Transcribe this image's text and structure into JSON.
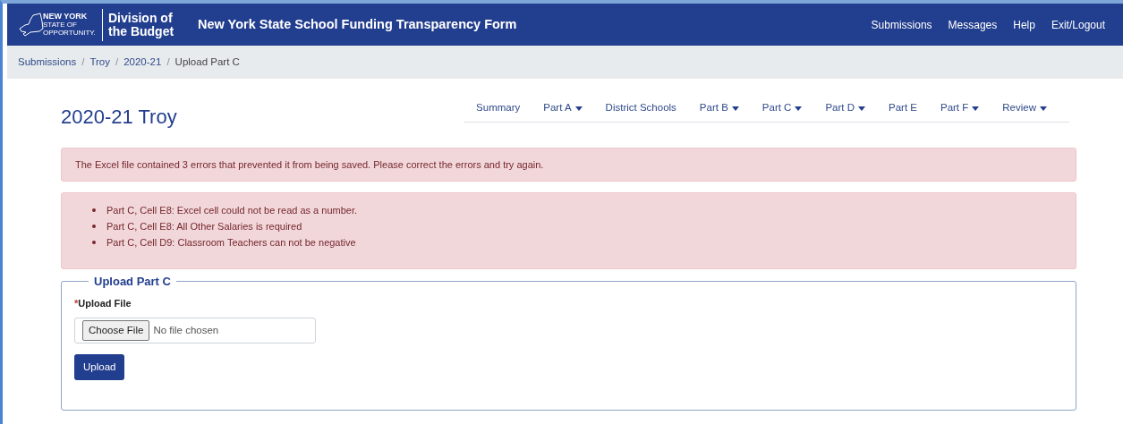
{
  "header": {
    "logo": {
      "state_name": "NEW YORK",
      "tagline": "STATE OF OPPORTUNITY.",
      "agency": "Division of the Budget"
    },
    "title": "New York State School Funding Transparency Form",
    "menu": [
      "Submissions",
      "Messages",
      "Help",
      "Exit/Logout"
    ]
  },
  "breadcrumb": {
    "links": [
      "Submissions",
      "Troy",
      "2020-21"
    ],
    "separator": "/",
    "current": "Upload Part C"
  },
  "page_title": "2020-21 Troy",
  "tabs": [
    {
      "label": "Summary",
      "dropdown": false
    },
    {
      "label": "Part A",
      "dropdown": true
    },
    {
      "label": "District Schools",
      "dropdown": false
    },
    {
      "label": "Part B",
      "dropdown": true
    },
    {
      "label": "Part C",
      "dropdown": true
    },
    {
      "label": "Part D",
      "dropdown": true
    },
    {
      "label": "Part E",
      "dropdown": false
    },
    {
      "label": "Part F",
      "dropdown": true
    },
    {
      "label": "Review",
      "dropdown": true
    }
  ],
  "error_summary": "The Excel file contained 3 errors that prevented it from being saved. Please correct the errors and try again.",
  "errors": [
    "Part C, Cell E8: Excel cell could not be read as a number.",
    "Part C, Cell E8: All Other Salaries is required",
    "Part C, Cell D9: Classroom Teachers can not be negative"
  ],
  "upload": {
    "legend": "Upload Part C",
    "required_mark": "*",
    "label": "Upload File",
    "choose_button": "Choose File",
    "file_status": "No file chosen",
    "submit": "Upload"
  }
}
